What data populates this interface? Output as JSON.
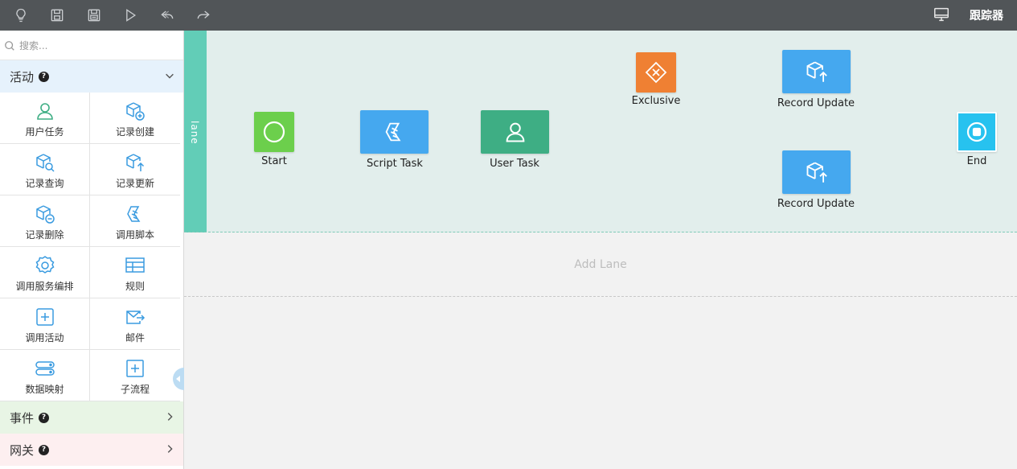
{
  "toolbar": {
    "icons": [
      "lightbulb-icon",
      "save-icon",
      "save-as-icon",
      "run-icon",
      "undo-icon",
      "redo-icon"
    ],
    "right_icon": "monitor-icon",
    "tracker_label": "跟踪器"
  },
  "sidebar": {
    "search_placeholder": "搜索...",
    "activity": {
      "label": "活动",
      "items": [
        {
          "label": "用户任务",
          "icon": "user-icon"
        },
        {
          "label": "记录创建",
          "icon": "record-create-icon"
        },
        {
          "label": "记录查询",
          "icon": "record-query-icon"
        },
        {
          "label": "记录更新",
          "icon": "record-update-icon"
        },
        {
          "label": "记录删除",
          "icon": "record-delete-icon"
        },
        {
          "label": "调用脚本",
          "icon": "script-icon"
        },
        {
          "label": "调用服务编排",
          "icon": "gear-icon"
        },
        {
          "label": "规则",
          "icon": "rule-table-icon"
        },
        {
          "label": "调用活动",
          "icon": "plus-square-icon"
        },
        {
          "label": "邮件",
          "icon": "mail-icon"
        },
        {
          "label": "数据映射",
          "icon": "data-map-icon"
        },
        {
          "label": "子流程",
          "icon": "subprocess-icon"
        }
      ]
    },
    "events": {
      "label": "事件"
    },
    "gateway": {
      "label": "网关"
    }
  },
  "canvas": {
    "lane_label": "lane",
    "add_lane_label": "Add Lane",
    "nodes": {
      "start": "Start",
      "script_task": "Script Task",
      "user_task": "User Task",
      "exclusive": "Exclusive",
      "record_update_1": "Record Update",
      "record_update_2": "Record Update",
      "end": "End"
    }
  },
  "colors": {
    "toolbar_bg": "#515558",
    "lane_strip": "#62cdb7",
    "pool_bg": "#e2eeec",
    "start": "#6ccf4c",
    "task_blue": "#45a8ef",
    "user_task": "#3eae84",
    "exclusive": "#ef8033",
    "end": "#27c2ef",
    "icon_green": "#3eae84",
    "icon_blue": "#3a9be0"
  }
}
